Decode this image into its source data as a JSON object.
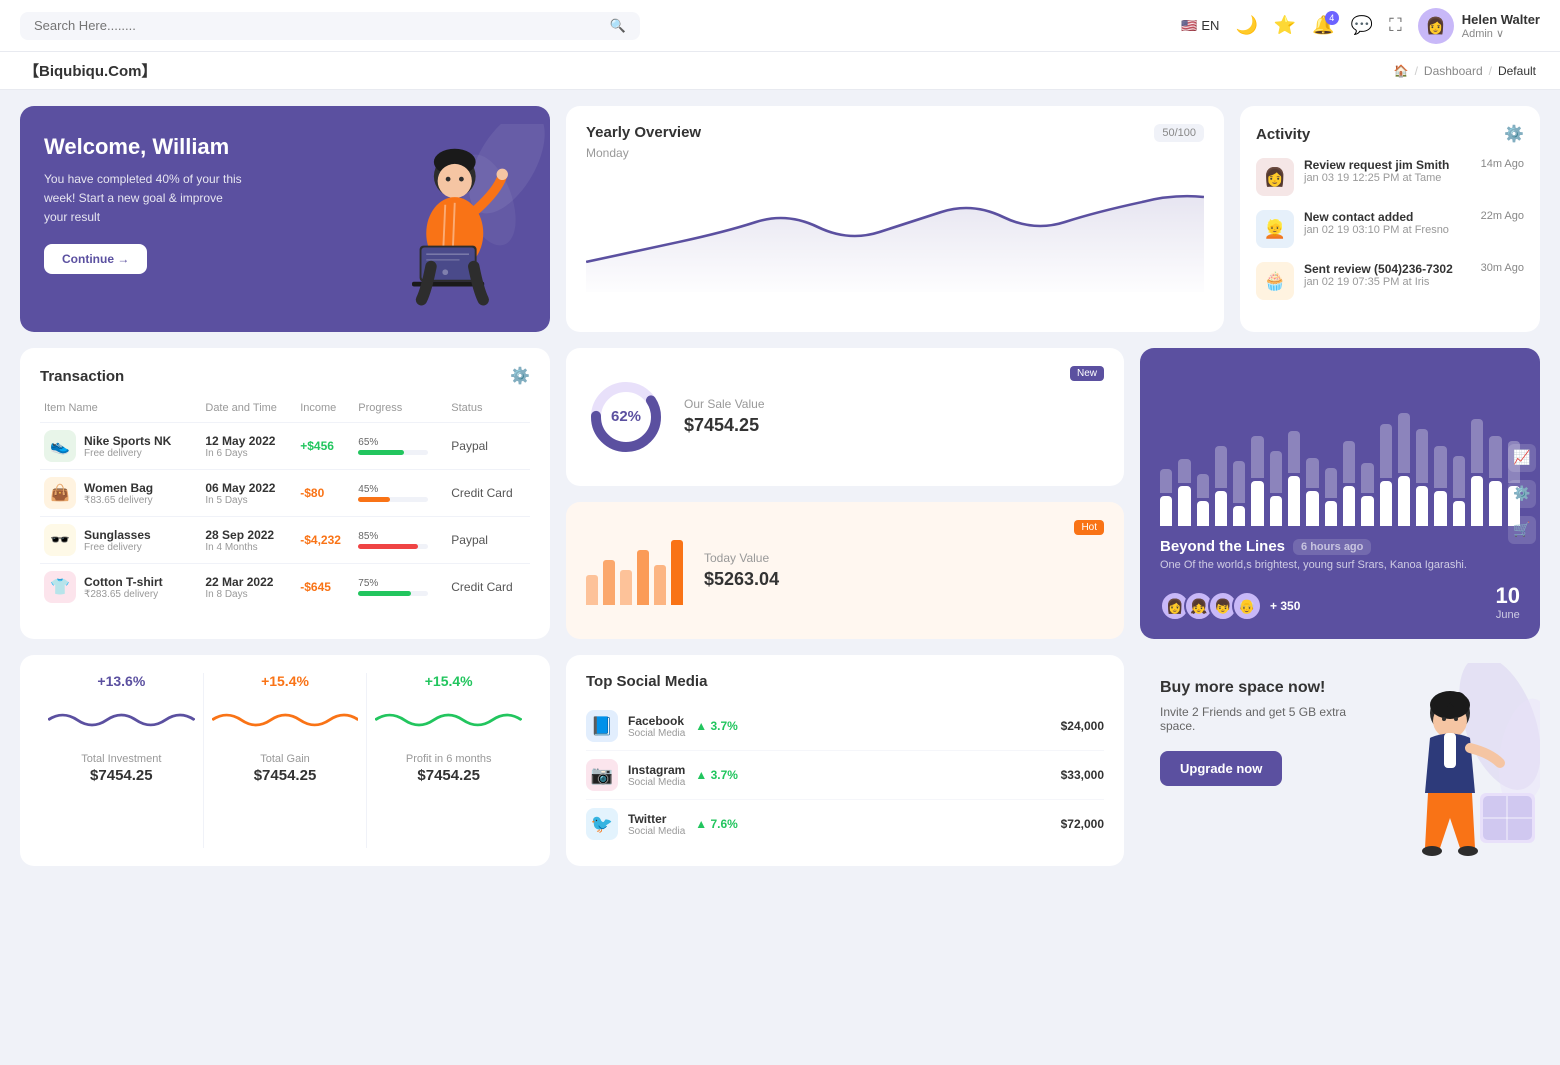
{
  "topnav": {
    "search_placeholder": "Search Here........",
    "lang": "EN",
    "user": {
      "name": "Helen Walter",
      "role": "Admin"
    },
    "notification_count": "4"
  },
  "breadcrumb": {
    "brand": "【Biqubiqu.Com】",
    "home": "🏠",
    "items": [
      "Dashboard",
      "Default"
    ]
  },
  "welcome": {
    "title": "Welcome, William",
    "subtitle": "You have completed 40% of your this week! Start a new goal & improve your result",
    "button": "Continue →"
  },
  "yearly": {
    "title": "Yearly Overview",
    "subtitle": "Monday",
    "badge": "50/100"
  },
  "activity": {
    "title": "Activity",
    "items": [
      {
        "title": "Review request jim Smith",
        "sub": "jan 03 19 12:25 PM at Tame",
        "time": "14m Ago",
        "emoji": "👩"
      },
      {
        "title": "New contact added",
        "sub": "jan 02 19 03:10 PM at Fresno",
        "time": "22m Ago",
        "emoji": "👱"
      },
      {
        "title": "Sent review (504)236-7302",
        "sub": "jan 02 19 07:35 PM at Iris",
        "time": "30m Ago",
        "emoji": "🧁"
      }
    ]
  },
  "transaction": {
    "title": "Transaction",
    "columns": [
      "Item Name",
      "Date and Time",
      "Income",
      "Progress",
      "Status"
    ],
    "rows": [
      {
        "name": "Nike Sports NK",
        "sub": "Free delivery",
        "date": "12 May 2022",
        "days": "In 6 Days",
        "income": "+$456",
        "income_type": "pos",
        "progress": 65,
        "status": "Paypal",
        "color": "#22c55e",
        "emoji": "👟",
        "icon_bg": "#e8f5e9"
      },
      {
        "name": "Women Bag",
        "sub": "₹83.65 delivery",
        "date": "06 May 2022",
        "days": "In 5 Days",
        "income": "-$80",
        "income_type": "neg",
        "progress": 45,
        "status": "Credit Card",
        "color": "#f97316",
        "emoji": "👜",
        "icon_bg": "#fff3e0"
      },
      {
        "name": "Sunglasses",
        "sub": "Free delivery",
        "date": "28 Sep 2022",
        "days": "In 4 Months",
        "income": "-$4,232",
        "income_type": "neg",
        "progress": 85,
        "status": "Paypal",
        "color": "#ef4444",
        "emoji": "🕶️",
        "icon_bg": "#fef9e7"
      },
      {
        "name": "Cotton T-shirt",
        "sub": "₹283.65 delivery",
        "date": "22 Mar 2022",
        "days": "In 8 Days",
        "income": "-$645",
        "income_type": "neg",
        "progress": 75,
        "status": "Credit Card",
        "color": "#22c55e",
        "emoji": "👕",
        "icon_bg": "#fce4ec"
      }
    ]
  },
  "sale": {
    "label": "Our Sale Value",
    "value": "$7454.25",
    "percent": "62%",
    "badge": "New"
  },
  "today": {
    "label": "Today Value",
    "value": "$5263.04",
    "badge": "Hot"
  },
  "beyond": {
    "title": "Beyond the Lines",
    "time": "6 hours ago",
    "sub": "One Of the world,s brightest, young surf Srars, Kanoa Igarashi.",
    "plus": "+ 350",
    "date_num": "10",
    "date_mon": "June"
  },
  "stats": [
    {
      "pct": "+13.6%",
      "label": "Total Investment",
      "value": "$7454.25",
      "color": "#5b50a0"
    },
    {
      "pct": "+15.4%",
      "label": "Total Gain",
      "value": "$7454.25",
      "color": "#f97316"
    },
    {
      "pct": "+15.4%",
      "label": "Profit in 6 months",
      "value": "$7454.25",
      "color": "#22c55e"
    }
  ],
  "social": {
    "title": "Top Social Media",
    "items": [
      {
        "name": "Facebook",
        "sub": "Social Media",
        "pct": "3.7%",
        "value": "$24,000",
        "color": "#1877f2",
        "emoji": "📘"
      },
      {
        "name": "Instagram",
        "sub": "Social Media",
        "pct": "3.7%",
        "value": "$33,000",
        "color": "#e1306c",
        "emoji": "📷"
      },
      {
        "name": "Twitter",
        "sub": "Social Media",
        "pct": "7.6%",
        "value": "$72,000",
        "color": "#1da1f2",
        "emoji": "🐦"
      }
    ]
  },
  "buyspace": {
    "title": "Buy more space now!",
    "sub": "Invite 2 Friends and get 5 GB extra space.",
    "button": "Upgrade now"
  }
}
